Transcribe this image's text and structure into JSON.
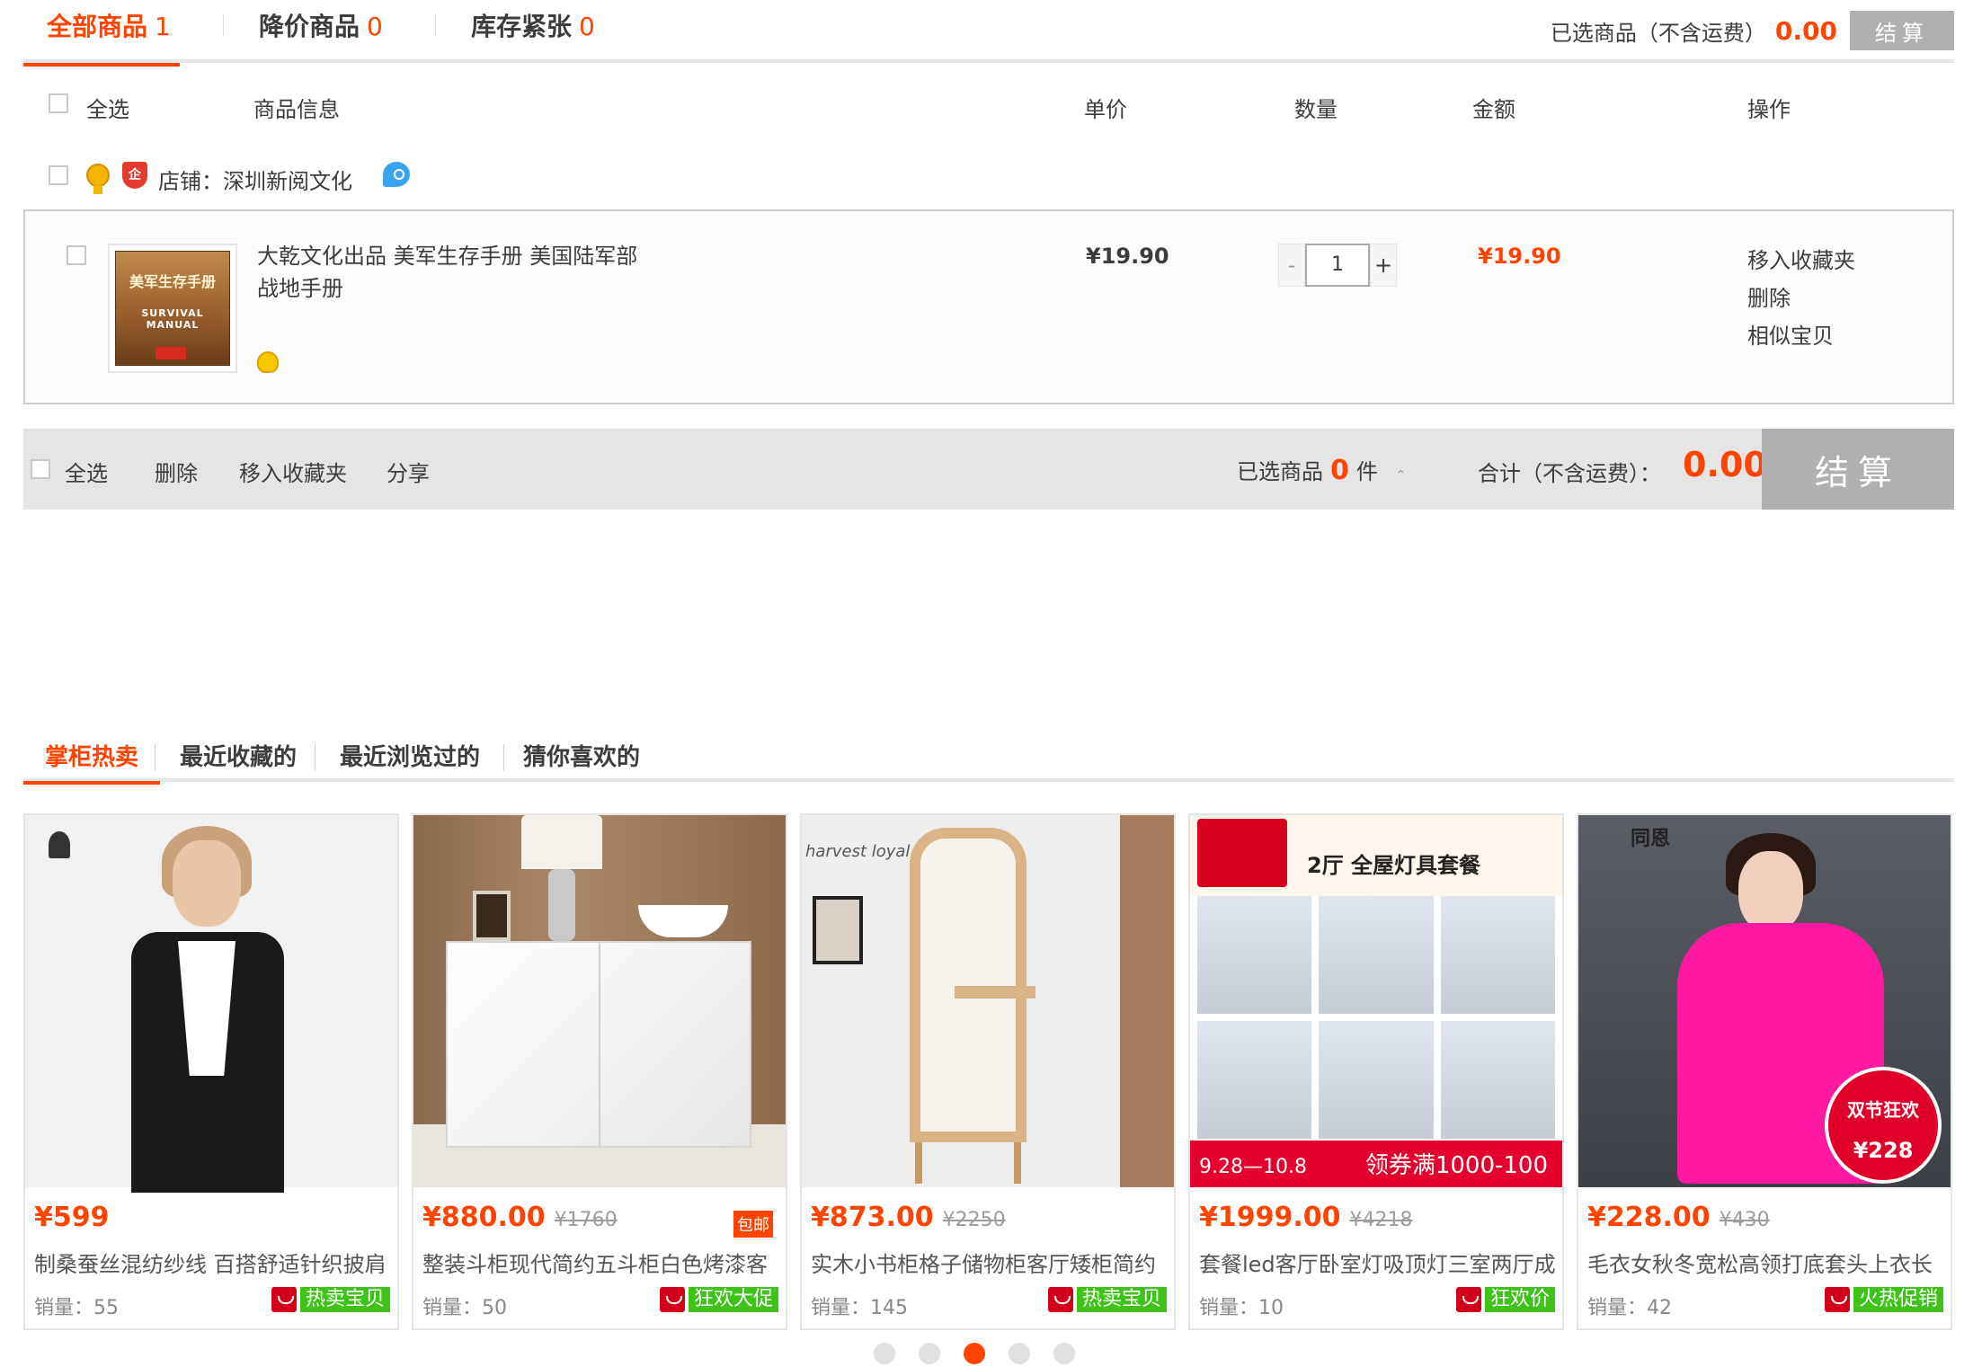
{
  "top_tabs": [
    {
      "label": "全部商品",
      "count": "1"
    },
    {
      "label": "降价商品",
      "count": "0"
    },
    {
      "label": "库存紧张",
      "count": "0"
    }
  ],
  "top_summary": {
    "label": "已选商品（不含运费）",
    "amount": "0.00",
    "checkout": "结算"
  },
  "table_header": {
    "select_all": "全选",
    "info": "商品信息",
    "unit_price": "单价",
    "quantity": "数量",
    "amount": "金额",
    "actions": "操作"
  },
  "shop": {
    "name": "店铺：深圳新阅文化"
  },
  "item": {
    "cover_title": "美军生存手册",
    "cover_subtitle": "SURVIVAL MANUAL",
    "title": "大乾文化出品 美军生存手册 美国陆军部战地手册",
    "price": "¥19.90",
    "qty_minus": "-",
    "qty": "1",
    "qty_plus": "+",
    "amount": "¥19.90",
    "actions": [
      "移入收藏夹",
      "删除",
      "相似宝贝"
    ]
  },
  "bottom_bar": {
    "select_all": "全选",
    "delete": "删除",
    "move_fav": "移入收藏夹",
    "share": "分享",
    "selected_prefix": "已选商品",
    "selected_count": "0",
    "selected_suffix": "件",
    "total_label": "合计（不含运费）：",
    "total_amount": "0.00",
    "checkout": "结算"
  },
  "rec_tabs": [
    "掌柜热卖",
    "最近收藏的",
    "最近浏览过的",
    "猜你喜欢的"
  ],
  "products": [
    {
      "price": "¥599",
      "orig": "",
      "free": "",
      "title": "制桑蚕丝混纺纱线 百搭舒适针织披肩",
      "sales": "销量：55",
      "tag": "热卖宝贝"
    },
    {
      "price": "¥880.00",
      "orig": "¥1760",
      "free": "包邮",
      "title": "整装斗柜现代简约五斗柜白色烤漆客",
      "sales": "销量：50",
      "tag": "狂欢大促"
    },
    {
      "price": "¥873.00",
      "orig": "¥2250",
      "free": "",
      "title": "实木小书柜格子储物柜客厅矮柜简约",
      "sales": "销量：145",
      "tag": "热卖宝贝",
      "brand": "harvest loyal"
    },
    {
      "price": "¥1999.00",
      "orig": "¥4218",
      "free": "",
      "title": "套餐led客厅卧室灯吸顶灯三室两厅成",
      "sales": "销量：10",
      "tag": "狂欢价",
      "headline": "2厅 全屋灯具套餐",
      "promo_left": "9.28—10.8",
      "promo_right": "领券满1000-100"
    },
    {
      "price": "¥228.00",
      "orig": "¥430",
      "free": "",
      "title": "毛衣女秋冬宽松高领打底套头上衣长",
      "sales": "销量：42",
      "tag": "火热促销",
      "brand": "同恩",
      "badge_line1": "双节狂欢",
      "badge_line2": "¥228"
    }
  ],
  "pager": {
    "count": 5,
    "active_index": 2
  },
  "colors": {
    "accent": "#ff4400",
    "tag_green": "#3fc21a",
    "checkout_gray": "#b0b0b0"
  }
}
